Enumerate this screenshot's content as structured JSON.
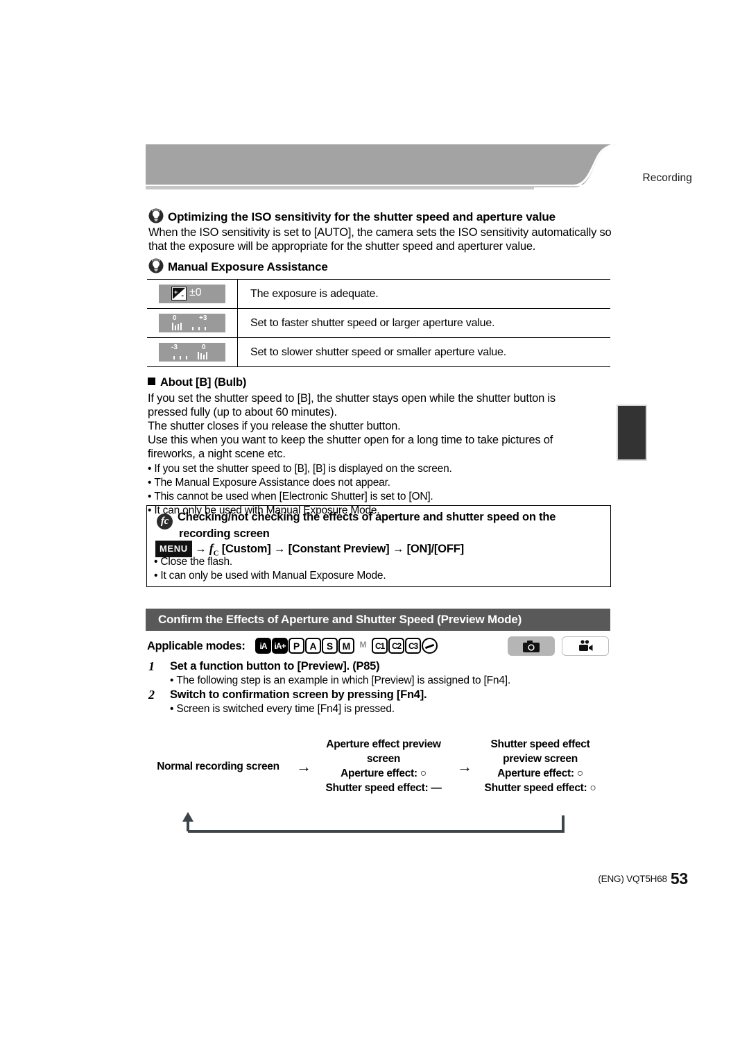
{
  "header": {
    "chapter_label": "Recording"
  },
  "iso_tip": {
    "icon": "lightbulb-icon",
    "title": "Optimizing the ISO sensitivity for the shutter speed and aperture value",
    "body_line1": "When the ISO sensitivity is set to [AUTO], the camera sets the ISO sensitivity automatically so",
    "body_line2": "that the exposure will be appropriate for the shutter speed and aperturer value."
  },
  "mea": {
    "icon": "lightbulb-icon",
    "title": "Manual Exposure Assistance",
    "rows": [
      {
        "icon_name": "exposure-adequate-icon",
        "chip_value": "±0",
        "description": "The exposure is adequate."
      },
      {
        "icon_name": "exposure-over-scale-icon",
        "left_label": "0",
        "right_label": "+3",
        "description": "Set to faster shutter speed or larger aperture value."
      },
      {
        "icon_name": "exposure-under-scale-icon",
        "left_label": "-3",
        "right_label": "0",
        "description": "Set to slower shutter speed or smaller aperture value."
      }
    ]
  },
  "bulb": {
    "heading": "About [B] (Bulb)",
    "paragraphs": [
      "If you set the shutter speed to [B], the shutter stays open while the shutter button is",
      "pressed fully (up to about 60 minutes).",
      "The shutter closes if you release the shutter button.",
      "Use this when you want to keep the shutter open for a long time to take pictures of",
      "fireworks, a night scene etc."
    ],
    "bullets": [
      "If you set the shutter speed to [B], [B] is displayed on the screen.",
      "The Manual Exposure Assistance does not appear.",
      "This cannot be used when [Electronic Shutter] is set to [ON].",
      "It can only be used with Manual Exposure Mode."
    ]
  },
  "constant_preview_box": {
    "icon": "fc-custom-icon",
    "title_line1": "Checking/not checking the effects of aperture and shutter speed on the",
    "title_line2": "recording screen",
    "menu_chip": "MENU",
    "path": {
      "arrow": "→",
      "custom_label": "[Custom]",
      "setting_label": "[Constant Preview]",
      "values_label": "[ON]/[OFF]"
    },
    "bullets": [
      "Close the flash.",
      "It can only be used with Manual Exposure Mode."
    ]
  },
  "section": {
    "title": "Confirm the Effects of Aperture and Shutter Speed (Preview Mode)",
    "applicable_label": "Applicable modes:",
    "mode_icons": [
      {
        "name": "intelligent-auto-icon",
        "text": "iA",
        "style": "filled"
      },
      {
        "name": "intelligent-auto-plus-icon",
        "text": "iA+",
        "style": "filled"
      },
      {
        "name": "program-ae-icon",
        "text": "P",
        "style": "box"
      },
      {
        "name": "aperture-priority-icon",
        "text": "A",
        "style": "box"
      },
      {
        "name": "shutter-priority-icon",
        "text": "S",
        "style": "box"
      },
      {
        "name": "manual-exposure-icon",
        "text": "M",
        "style": "box"
      },
      {
        "name": "creative-video-icon",
        "text": "M",
        "style": "plain-disabled"
      },
      {
        "name": "custom1-icon",
        "text": "C1",
        "style": "box-small"
      },
      {
        "name": "custom2-icon",
        "text": "C2",
        "style": "box-small"
      },
      {
        "name": "custom3-icon",
        "text": "C3",
        "style": "box-small"
      },
      {
        "name": "creative-control-icon",
        "text": "",
        "style": "circle"
      }
    ],
    "pills": [
      {
        "name": "photo-mode-pill",
        "icon": "camera-icon",
        "state": "on"
      },
      {
        "name": "video-mode-pill",
        "icon": "video-camera-icon",
        "state": "off"
      }
    ]
  },
  "steps": [
    {
      "number": "1",
      "title": "Set a function button to [Preview]. (P85)",
      "bullet": "The following step is an example in which [Preview] is assigned to [Fn4]."
    },
    {
      "number": "2",
      "title": "Switch to confirmation screen by pressing [Fn4].",
      "bullet": "Screen is switched every time [Fn4] is pressed."
    }
  ],
  "flow": {
    "node1": {
      "line1": "Normal recording screen"
    },
    "arrow": "→",
    "node2": {
      "line1": "Aperture effect preview",
      "line2": "screen",
      "line3": "Aperture effect: ○",
      "line4": "Shutter speed effect: —"
    },
    "node3": {
      "line1": "Shutter speed effect",
      "line2": "preview screen",
      "line3": "Aperture effect: ○",
      "line4": "Shutter speed effect: ○"
    },
    "return_path_name": "loop-back-arrow"
  },
  "footer": {
    "code": "(ENG) VQT5H68",
    "page_number": "53"
  }
}
